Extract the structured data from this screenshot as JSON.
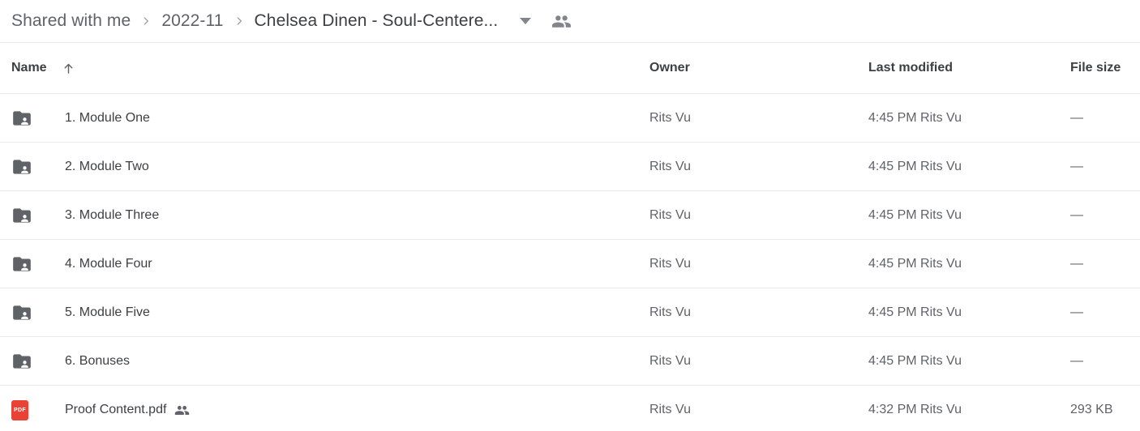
{
  "breadcrumb": {
    "items": [
      {
        "label": "Shared with me",
        "current": false
      },
      {
        "label": "2022-11",
        "current": false
      },
      {
        "label": "Chelsea Dinen - Soul-Centere...",
        "current": true
      }
    ],
    "caret_icon": "chevron-down-icon",
    "separator_icon": "chevron-right-icon",
    "people_icon": "people-icon"
  },
  "table": {
    "columns": {
      "name": "Name",
      "owner": "Owner",
      "modified": "Last modified",
      "size": "File size"
    },
    "sort": {
      "column": "Name",
      "direction": "ascending",
      "icon": "arrow-up-icon"
    },
    "rows": [
      {
        "icon": "shared-folder-icon",
        "type": "folder",
        "name": "1. Module One",
        "shared": false,
        "owner": "Rits Vu",
        "modified": "4:45 PM Rits Vu",
        "size": "—"
      },
      {
        "icon": "shared-folder-icon",
        "type": "folder",
        "name": "2. Module Two",
        "shared": false,
        "owner": "Rits Vu",
        "modified": "4:45 PM Rits Vu",
        "size": "—"
      },
      {
        "icon": "shared-folder-icon",
        "type": "folder",
        "name": "3. Module Three",
        "shared": false,
        "owner": "Rits Vu",
        "modified": "4:45 PM Rits Vu",
        "size": "—"
      },
      {
        "icon": "shared-folder-icon",
        "type": "folder",
        "name": "4. Module Four",
        "shared": false,
        "owner": "Rits Vu",
        "modified": "4:45 PM Rits Vu",
        "size": "—"
      },
      {
        "icon": "shared-folder-icon",
        "type": "folder",
        "name": "5. Module Five",
        "shared": false,
        "owner": "Rits Vu",
        "modified": "4:45 PM Rits Vu",
        "size": "—"
      },
      {
        "icon": "shared-folder-icon",
        "type": "folder",
        "name": "6. Bonuses",
        "shared": false,
        "owner": "Rits Vu",
        "modified": "4:45 PM Rits Vu",
        "size": "—"
      },
      {
        "icon": "pdf-file-icon",
        "icon_label": "PDF",
        "type": "file",
        "name": "Proof Content.pdf",
        "shared": true,
        "owner": "Rits Vu",
        "modified": "4:32 PM Rits Vu",
        "size": "293 KB"
      }
    ]
  },
  "colors": {
    "folder_gray": "#5f6368",
    "pdf_red": "#ea4335",
    "text_primary": "#3c4043",
    "text_secondary": "#5f6368",
    "divider": "#e8eaed"
  }
}
